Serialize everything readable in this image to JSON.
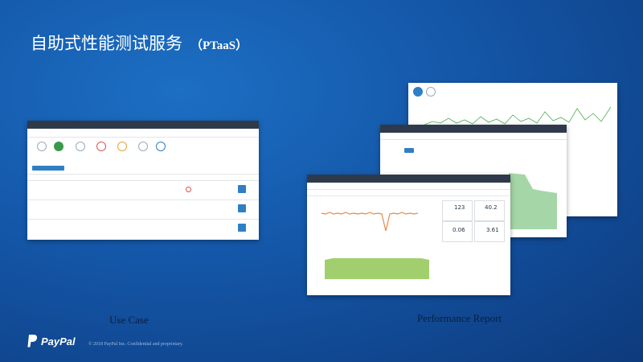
{
  "title": {
    "zh": "自助式性能测试服务",
    "en": "（PTaaS）"
  },
  "captions": {
    "left": "Use Case",
    "right": "Performance Report"
  },
  "footer": {
    "brand": "PayPal",
    "copyright": "© 2018 PayPal Inc. Confidential and proprietary."
  },
  "colors": {
    "background": "#1456a7",
    "chart_green": "#4caf50",
    "chart_orange": "#e8884a",
    "accent_blue": "#2f7fc4",
    "alert_red": "#d9534f"
  },
  "icons": [
    "paypal-logo-icon",
    "step-circle-icon",
    "edit-icon"
  ],
  "screenshots": {
    "use_case": {
      "description_hidden": true
    },
    "report_front": {
      "stats": [
        "123",
        "40.2",
        "0.06",
        "3.61"
      ]
    }
  }
}
